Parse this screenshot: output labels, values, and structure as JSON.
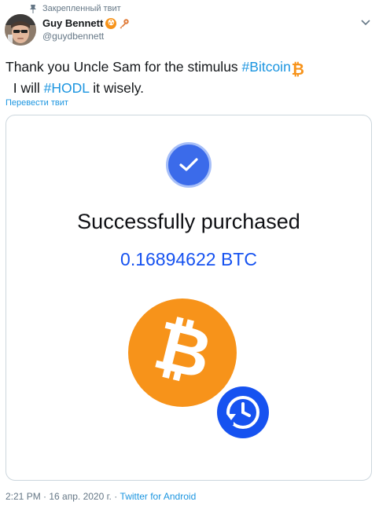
{
  "pinned": {
    "label": "Закрепленный твит"
  },
  "author": {
    "name": "Guy Bennett",
    "handle": "@guydbennett"
  },
  "tweet": {
    "text_part1": "Thank you Uncle Sam for the stimulus ",
    "hashtag1": "#Bitcoin",
    "bitcoin_emoji": "₿",
    "text_part2": "  I will ",
    "hashtag2": "#HODL",
    "text_part3": " it wisely.",
    "translate_label": "Перевести твит"
  },
  "card": {
    "title": "Successfully purchased",
    "amount": "0.16894622 BTC",
    "coin_symbol": "₿"
  },
  "footer": {
    "time": "2:21 PM",
    "separator1": " · ",
    "date": "16 апр. 2020 г.",
    "separator2": " · ",
    "source": "Twitter for Android"
  },
  "colors": {
    "bitcoin_orange": "#f7931a",
    "link_blue": "#1b95e0",
    "coinbase_blue": "#1652f0",
    "check_blue": "#3b6bea"
  },
  "icons": {
    "pin": "pin-icon",
    "badge1": "bitcoin-badge-icon",
    "badge2": "key-icon",
    "menu": "chevron-down-icon",
    "check": "checkmark-icon",
    "coin": "bitcoin-coin-icon",
    "recurring": "recurring-clock-icon"
  }
}
